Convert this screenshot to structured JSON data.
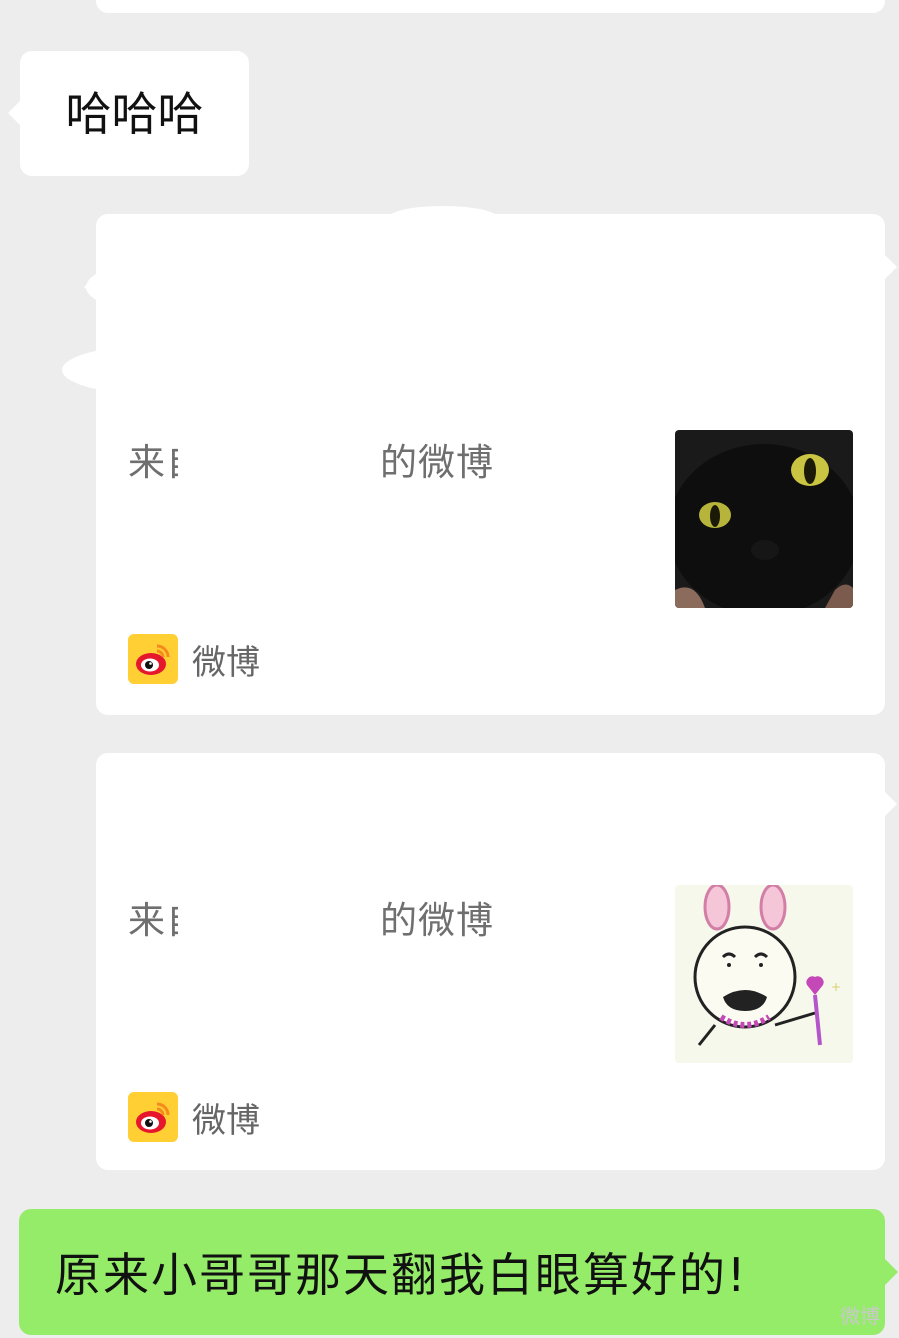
{
  "chat": {
    "messages": [
      {
        "type": "text",
        "side": "left",
        "text": "哈哈哈"
      },
      {
        "type": "share_card",
        "side": "left",
        "title_start": "来自",
        "title_end": "的微博",
        "thumbnail": "black-cat-face",
        "source": "微博"
      },
      {
        "type": "share_card",
        "side": "left",
        "title_start": "来自",
        "title_end": "的微博",
        "thumbnail": "bunny-ears-doodle",
        "source": "微博"
      },
      {
        "type": "text",
        "side": "right",
        "text": "原来小哥哥那天翻我白眼算好的!"
      }
    ],
    "watermark": "微博"
  },
  "colors": {
    "background": "#ededed",
    "incoming_bubble": "#ffffff",
    "outgoing_bubble": "#95ec69",
    "card_title": "#6f6f6f",
    "weibo_yellow": "#ffcf33",
    "weibo_red": "#e6162d"
  }
}
